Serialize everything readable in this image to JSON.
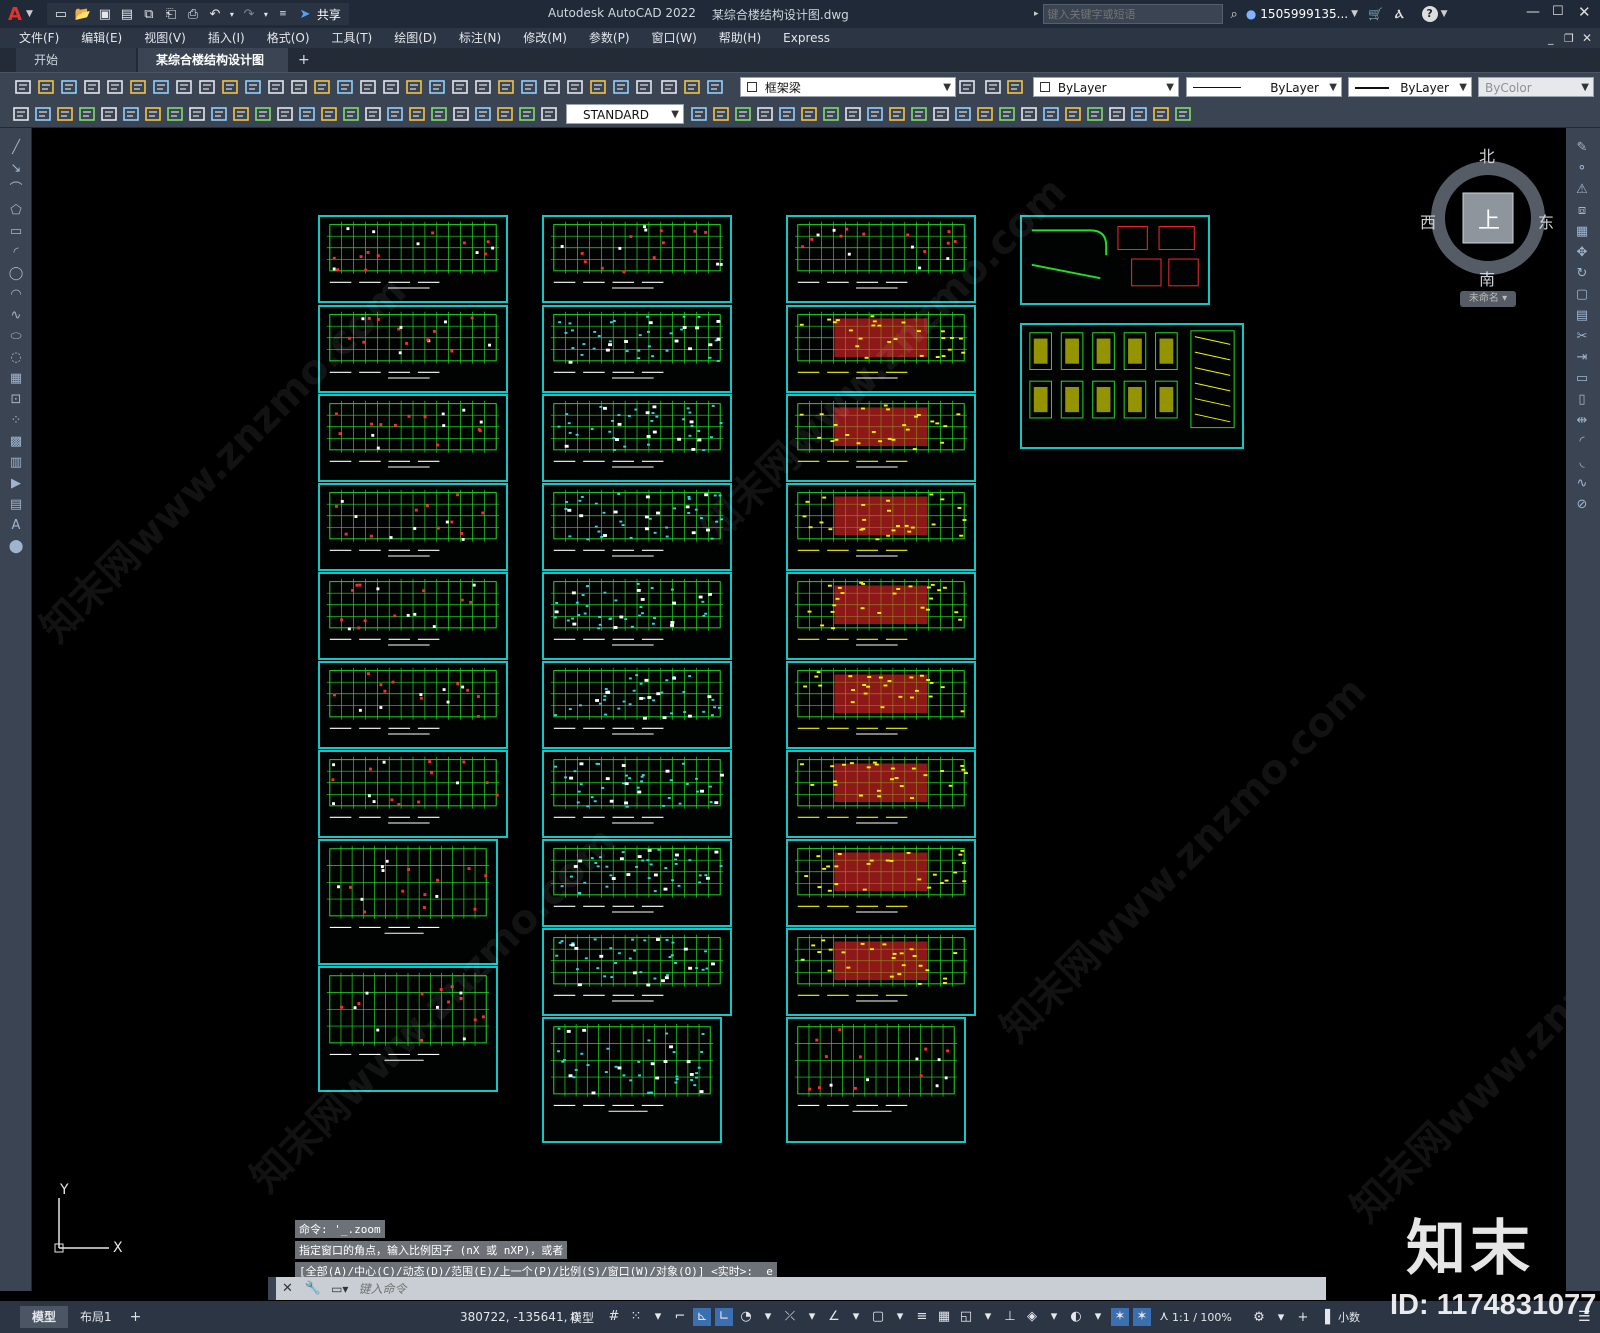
{
  "app": {
    "title": "Autodesk AutoCAD 2022",
    "document": "某综合楼结构设计图.dwg",
    "share": "共享",
    "search_placeholder": "键入关键字或短语",
    "user": "1505999135...",
    "logo_letter": "A"
  },
  "menu": [
    "文件(F)",
    "编辑(E)",
    "视图(V)",
    "插入(I)",
    "格式(O)",
    "工具(T)",
    "绘图(D)",
    "标注(N)",
    "修改(M)",
    "参数(P)",
    "窗口(W)",
    "帮助(H)",
    "Express"
  ],
  "tabs": [
    {
      "label": "开始"
    },
    {
      "label": "某综合楼结构设计图*"
    }
  ],
  "toolbar": {
    "layer": "框架梁",
    "color": "ByLayer",
    "linetype": "ByLayer",
    "lineweight": "ByLayer",
    "plotstyle": "ByColor",
    "textstyle": "STANDARD"
  },
  "viewcube": {
    "north": "北",
    "south": "南",
    "east": "东",
    "west": "西",
    "top": "上",
    "wcs": "未命名"
  },
  "command": {
    "history": [
      "命令: '_.zoom",
      "指定窗口的角点，输入比例因子 (nX 或 nXP)，或者",
      "[全部(A)/中心(C)/动态(D)/范围(E)/上一个(P)/比例(S)/窗口(W)/对象(O)] <实时>: _e"
    ],
    "placeholder": "键入命令"
  },
  "status": {
    "model_tab": "模型",
    "layout_tab": "布局1",
    "coords": "380722, -135641, 0",
    "mode": "模型",
    "scale": "1:1 / 100%",
    "units": "小数"
  },
  "ucs": {
    "x": "X",
    "y": "Y"
  },
  "watermark": {
    "brand": "知末",
    "id": "ID: 1174831077",
    "diag": "知末网www.znzmo.com"
  },
  "colors": {
    "sheet_border": "#14c7c7",
    "grid": "#21e021",
    "red": "#ff2a2a",
    "yellow": "#f5f500",
    "cyan": "#29d9e6",
    "white": "#ffffff"
  }
}
